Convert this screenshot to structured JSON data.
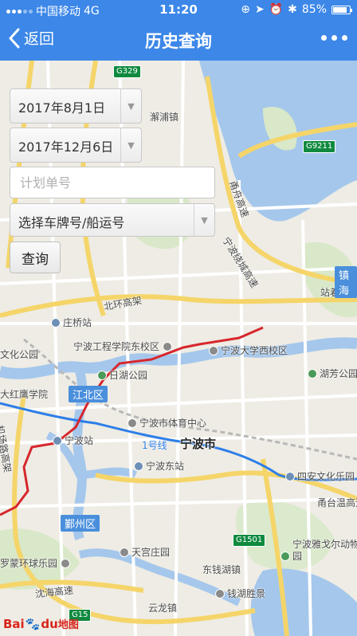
{
  "status_bar": {
    "carrier": "中国移动",
    "network": "4G",
    "time": "11:20",
    "battery_text": "85%",
    "battery_level": 0.85
  },
  "nav": {
    "back_label": "返回",
    "title": "历史查询"
  },
  "form": {
    "start_date": "2017年8月1日",
    "end_date": "2017年12月6日",
    "plan_number_placeholder": "计划单号",
    "vehicle_select": "选择车牌号/船运号",
    "query_button": "查询"
  },
  "map": {
    "labels": {
      "xiepu": "澥浦镇",
      "yongjiang_bridge": "甬舟高速",
      "yongcheng_highway": "宁波绕城高速",
      "beihuan": "北环高架",
      "zhuangqiao": "庄桥站",
      "nbgc": "宁波工程学院东校区",
      "nbu": "宁波大学西校区",
      "wenhua_park": "文化公园",
      "rihu_park": "日湖公园",
      "hongying": "大红鹰学院",
      "airport_road": "机场路高架",
      "nb_station": "宁波站",
      "stadium": "宁波市体育中心",
      "line1": "1号线",
      "nb_city": "宁波市",
      "east_station": "宁波东站",
      "huru": "湖芳公园",
      "zhangzhu": "站着站",
      "zhenhai": "镇海",
      "siane": "四安文化乐园",
      "yongtai": "甬台温高速",
      "tiangong": "天宫庄园",
      "luomeng": "罗蒙环球乐园",
      "zoo": "宁波雅戈尔动物园",
      "dongqian": "东钱湖镇",
      "qianhu": "钱湖胜景",
      "yanhai": "沈海高速",
      "yunlong": "云龙镇"
    },
    "districts": {
      "jiangbei": "江北区",
      "yinzhou": "鄞州区"
    },
    "shields": {
      "g329": "G329",
      "g9211": "G9211",
      "g1501": "G1501",
      "g15": "G15"
    },
    "logo": {
      "bai": "Bai",
      "du": "du",
      "map": "地图"
    }
  },
  "colors": {
    "nav_blue": "#3c87e8",
    "track_red": "#d7262d",
    "metro_blue": "#2d7ee8"
  }
}
